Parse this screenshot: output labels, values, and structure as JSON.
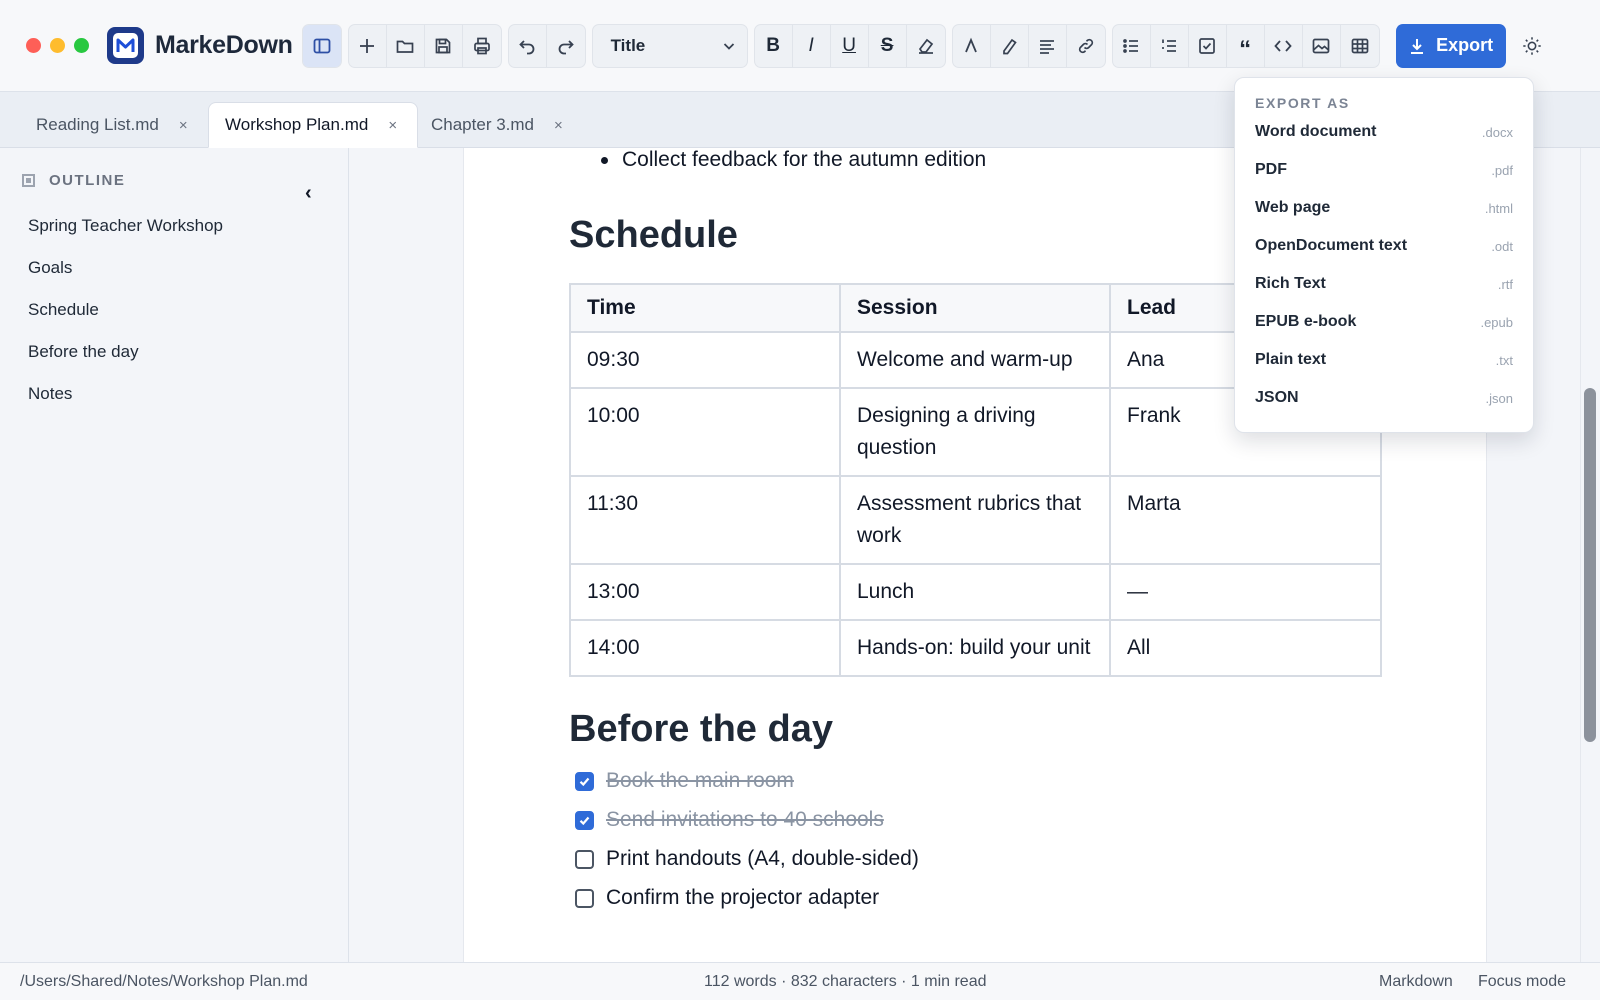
{
  "app": {
    "name": "MarkeDown"
  },
  "toolbar": {
    "style_select": "Title",
    "export_label": "Export"
  },
  "tabs": [
    {
      "label": "Reading List.md",
      "close": "×"
    },
    {
      "label": "Workshop Plan.md",
      "close": "×"
    },
    {
      "label": "Chapter 3.md",
      "close": "×"
    }
  ],
  "sidebar": {
    "header": "OUTLINE",
    "collapse": "‹",
    "items": [
      {
        "label": "Spring Teacher Workshop"
      },
      {
        "label": "Goals"
      },
      {
        "label": "Schedule"
      },
      {
        "label": "Before the day"
      },
      {
        "label": "Notes"
      }
    ]
  },
  "document": {
    "bullet": "Collect feedback for the autumn edition",
    "schedule_heading": "Schedule",
    "table": {
      "headers": [
        "Time",
        "Session",
        "Lead"
      ],
      "rows": [
        [
          "09:30",
          "Welcome and warm-up",
          "Ana"
        ],
        [
          "10:00",
          "Designing a driving question",
          "Frank"
        ],
        [
          "11:30",
          "Assessment rubrics that work",
          "Marta"
        ],
        [
          "13:00",
          "Lunch",
          "—"
        ],
        [
          "14:00",
          "Hands-on: build your unit",
          "All"
        ]
      ]
    },
    "before_heading": "Before the day",
    "tasks": [
      {
        "text": "Book the main room",
        "done": true
      },
      {
        "text": "Send invitations to 40 schools",
        "done": true
      },
      {
        "text": "Print handouts (A4, double-sided)",
        "done": false
      },
      {
        "text": "Confirm the projector adapter",
        "done": false
      }
    ]
  },
  "export_menu": {
    "header": "EXPORT AS",
    "items": [
      {
        "label": "Word document",
        "ext": ".docx"
      },
      {
        "label": "PDF",
        "ext": ".pdf"
      },
      {
        "label": "Web page",
        "ext": ".html"
      },
      {
        "label": "OpenDocument text",
        "ext": ".odt"
      },
      {
        "label": "Rich Text",
        "ext": ".rtf"
      },
      {
        "label": "EPUB e-book",
        "ext": ".epub"
      },
      {
        "label": "Plain text",
        "ext": ".txt"
      },
      {
        "label": "JSON",
        "ext": ".json"
      }
    ]
  },
  "statusbar": {
    "path": "/Users/Shared/Notes/Workshop Plan.md",
    "counts": "112 words · 832 characters · 1 min read",
    "mode": "Markdown",
    "focus": "Focus mode"
  },
  "colors": {
    "accent": "#2f6bd8",
    "brand": "#1e3a8a"
  }
}
